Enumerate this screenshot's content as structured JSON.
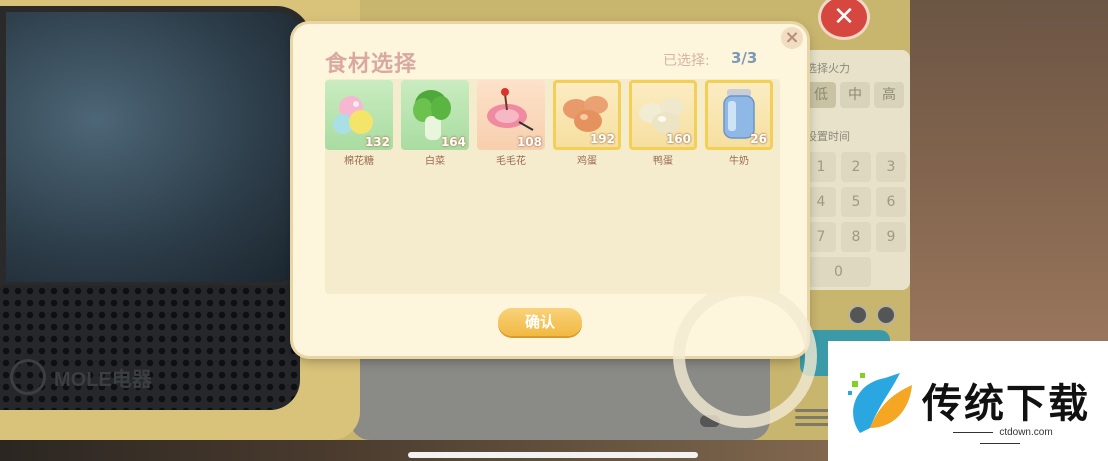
{
  "background": {
    "brand": "MOLE电器",
    "side_panel": {
      "heat_label": "选择火力",
      "heat_options": [
        "低",
        "中",
        "高"
      ],
      "time_label": "设置时间",
      "keys": [
        "1",
        "2",
        "3",
        "4",
        "5",
        "6",
        "7",
        "8",
        "9",
        "0"
      ]
    }
  },
  "dialog": {
    "title": "食材选择",
    "selected_label": "已选择:",
    "selected_count": "3/3",
    "items": [
      {
        "name": "棉花糖",
        "qty": "132",
        "selected": false
      },
      {
        "name": "白菜",
        "qty": "164",
        "selected": false
      },
      {
        "name": "毛毛花",
        "qty": "108",
        "selected": false
      },
      {
        "name": "鸡蛋",
        "qty": "192",
        "selected": true
      },
      {
        "name": "鸭蛋",
        "qty": "160",
        "selected": true
      },
      {
        "name": "牛奶",
        "qty": "26",
        "selected": true
      }
    ],
    "confirm_label": "确认"
  },
  "watermark": {
    "title": "传统下载",
    "url": "ctdown.com"
  },
  "colors": {
    "title": "#d9a9a1",
    "selected_border": "#f4cf55",
    "confirm": "#f1b942",
    "close_red": "#d6473f"
  }
}
